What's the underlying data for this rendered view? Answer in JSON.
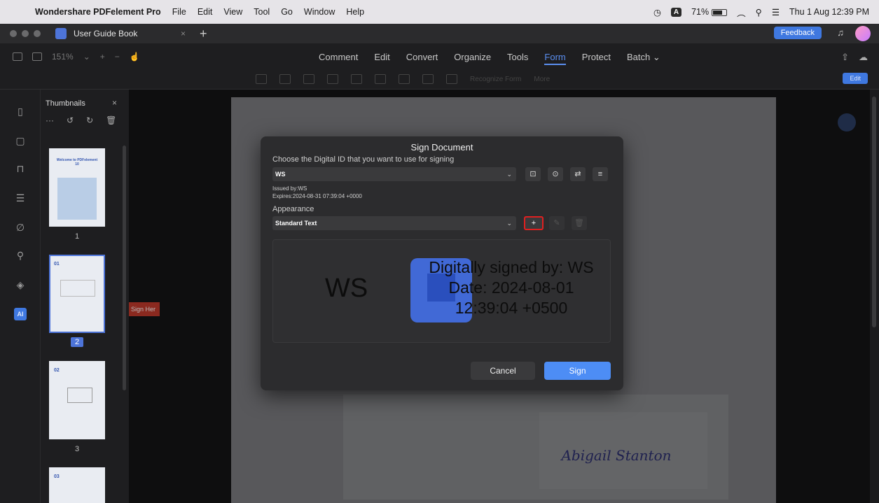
{
  "menubar": {
    "app_name": "Wondershare PDFelement Pro",
    "items": [
      "File",
      "Edit",
      "View",
      "Tool",
      "Go",
      "Window",
      "Help"
    ],
    "input_badge": "A",
    "battery": "71%",
    "datetime": "Thu 1 Aug  12:39 PM"
  },
  "tabbar": {
    "doc_title": "User Guide Book",
    "close_glyph": "×",
    "new_tab_glyph": "+",
    "feedback_label": "Feedback"
  },
  "toolbar": {
    "zoom": "151%",
    "menu": [
      "Comment",
      "Edit",
      "Convert",
      "Organize",
      "Tools",
      "Form",
      "Protect",
      "Batch"
    ],
    "active_menu": "Form",
    "recognize_form": "Recognize Form",
    "more": "More",
    "edit_label": "Edit"
  },
  "thumbnails": {
    "title": "Thumbnails",
    "close_glyph": "×",
    "pages": [
      {
        "label": "1",
        "selected": false
      },
      {
        "label": "2",
        "selected": true
      },
      {
        "label": "3",
        "selected": false
      }
    ],
    "thumb_titles": [
      "Welcome to PDFelement 10",
      "01",
      "02",
      "03"
    ]
  },
  "document": {
    "sign_here": "Sign Her",
    "signature_text": "Abigail Stanton"
  },
  "dialog": {
    "title": "Sign Document",
    "choose_label": "Choose the Digital ID that you want to use for signing",
    "digital_id": "WS",
    "issued_by": "Issued by:WS",
    "expires": "Expires:2024-08-31 07:39:04 +0000",
    "appearance_label": "Appearance",
    "appearance_value": "Standard Text",
    "add_glyph": "+",
    "preview": {
      "name": "WS",
      "line1": "Digitally signed by: WS",
      "line2": "Date: 2024-08-01",
      "line3": "12:39:04 +0500"
    },
    "cancel_label": "Cancel",
    "sign_label": "Sign"
  },
  "colors": {
    "accent": "#4d8df5",
    "highlight": "#e02020"
  }
}
